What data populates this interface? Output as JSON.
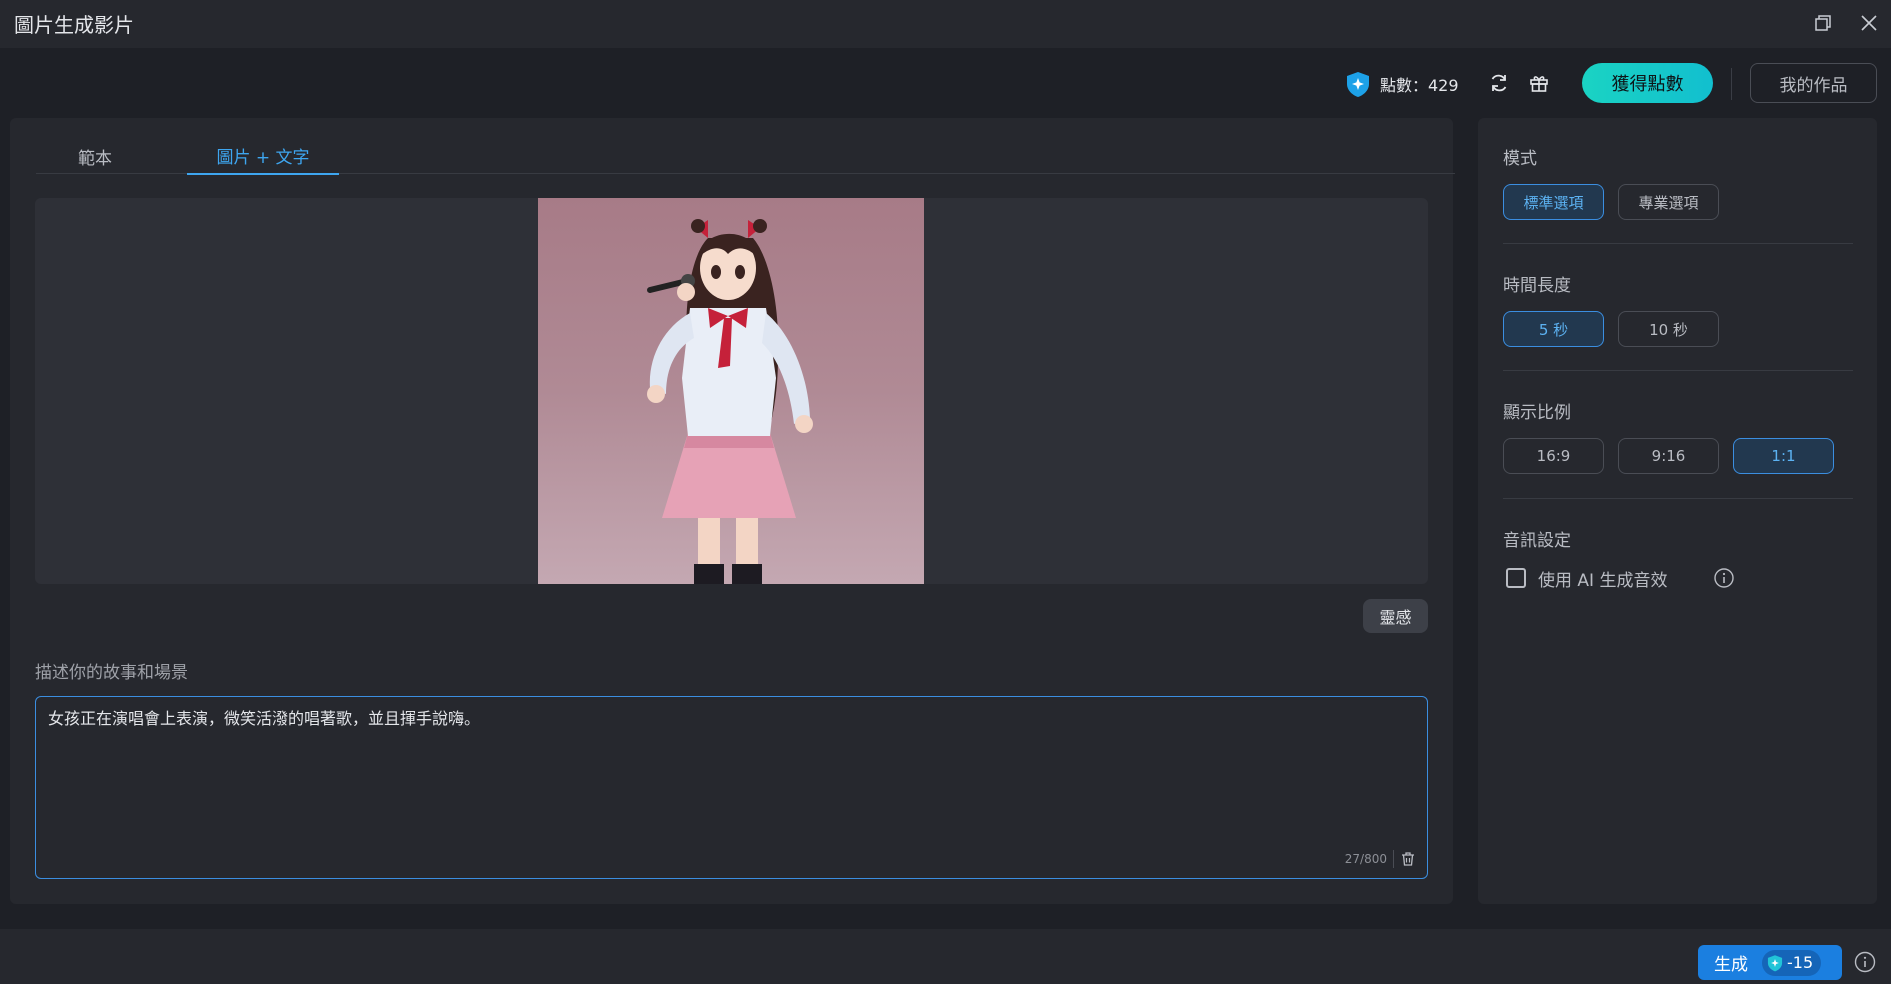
{
  "window": {
    "title": "圖片生成影片"
  },
  "header": {
    "points_label": "點數：429",
    "get_points_label": "獲得點數",
    "my_works_label": "我的作品"
  },
  "tabs": [
    {
      "label": "範本",
      "active": false
    },
    {
      "label": "圖片 + 文字",
      "active": true
    }
  ],
  "editor": {
    "inspiration_label": "靈感",
    "story_label": "描述你的故事和場景",
    "prompt_value": "女孩正在演唱會上表演，微笑活潑的唱著歌，並且揮手說嗨。",
    "char_count": "27/800"
  },
  "settings": {
    "mode": {
      "title": "模式",
      "options": [
        "標準選項",
        "專業選項"
      ],
      "selected": "標準選項"
    },
    "duration": {
      "title": "時間長度",
      "options": [
        "5 秒",
        "10 秒"
      ],
      "selected": "5 秒"
    },
    "ratio": {
      "title": "顯示比例",
      "options": [
        "16:9",
        "9:16",
        "1:1"
      ],
      "selected": "1:1"
    },
    "audio": {
      "title": "音訊設定",
      "checkbox_label": "使用 AI 生成音效",
      "checked": false
    }
  },
  "footer": {
    "generate_label": "生成",
    "cost": "-15"
  },
  "colors": {
    "accent_blue": "#3ea6f0",
    "accent_teal": "#1ad3c3",
    "generate_blue": "#1b7fe0"
  },
  "icons": [
    "close-icon",
    "restore-icon",
    "points-shield-icon",
    "refresh-icon",
    "gift-icon",
    "trash-icon",
    "info-icon"
  ]
}
